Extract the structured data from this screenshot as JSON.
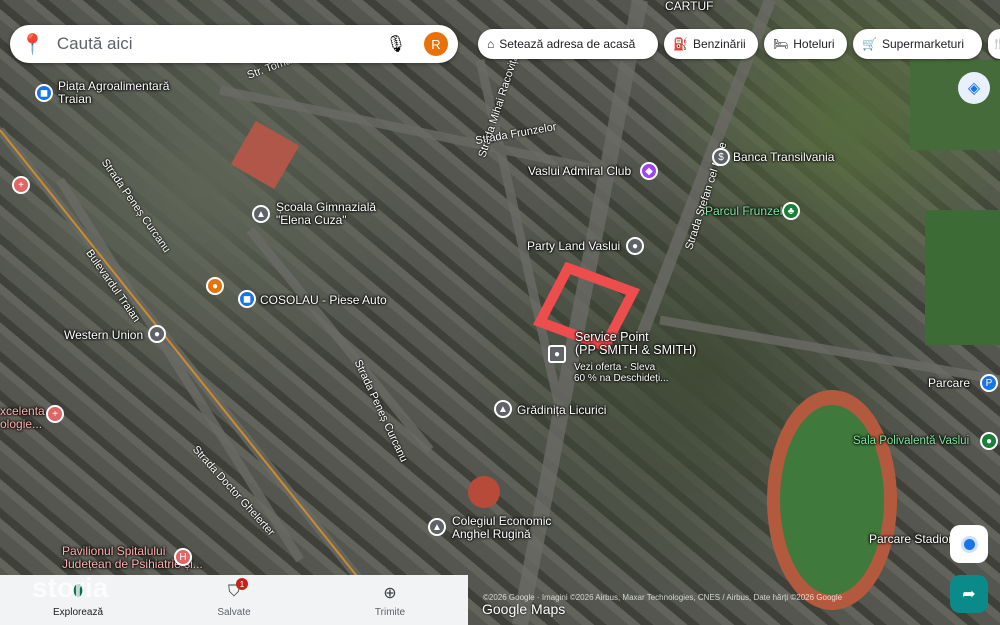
{
  "search": {
    "placeholder": "Caută aici",
    "avatar_letter": "R"
  },
  "chips": [
    {
      "icon": "home-icon",
      "label": "Setează adresa de acasă"
    },
    {
      "icon": "gas-station-icon",
      "label": "Benzinării"
    },
    {
      "icon": "hotel-icon",
      "label": "Hoteluri"
    },
    {
      "icon": "cart-icon",
      "label": "Supermarketuri"
    }
  ],
  "places": {
    "piata": "Piața Agroalimentară\nTraian",
    "scoala": "Școala Gimnazială\n\"Elena Cuza\"",
    "cosolau": "COSOLAU - Piese Auto",
    "western": "Western Union",
    "excelenta": "xcelenta\nologie...",
    "pavilion": "Pavilionul Spitalului\nJudețean de Psihiatrie și...",
    "vaslui_admiral": "Vaslui Admiral Club",
    "party": "Party Land Vaslui",
    "banca": "Banca Transilvania",
    "parcul": "Parcul Frunzelor",
    "service": "Service Point\n(PP SMITH & SMITH)",
    "service_sub": "Vezi oferta - Sleva\n60 % na Deschideți...",
    "gradinita": "Grădinița Licurici",
    "colegiu": "Colegiul Economic\nAnghel Rugină",
    "sala": "Sala Polivalentă Vaslui",
    "parcare": "Parcare",
    "parcare_stadion": "Parcare Stadion",
    "cartuf": "CARTUF"
  },
  "streets": {
    "toma": "Str. Toma Caragiu",
    "racovita": "Strada Mihai Racoviță",
    "frunzelor": "Strada Frunzelor",
    "stefan": "Strada Ștefan cel Mare",
    "penes1": "Strada Peneș Curcanu",
    "penes2": "Strada Peneș Curcanu",
    "traian": "Bulevardul Traian",
    "ghelerter": "Strada Doctor Ghelerter"
  },
  "attribution": "©2026 Google · Imagini ©2026 Airbus, Maxar Technologies, CNES / Airbus, Date hărți ©2026 Google",
  "google_maps": "Google Maps",
  "watermark": "storia",
  "nav": [
    {
      "label": "Explorează"
    },
    {
      "label": "Salvate",
      "badge": "1"
    },
    {
      "label": "Trimite"
    }
  ]
}
